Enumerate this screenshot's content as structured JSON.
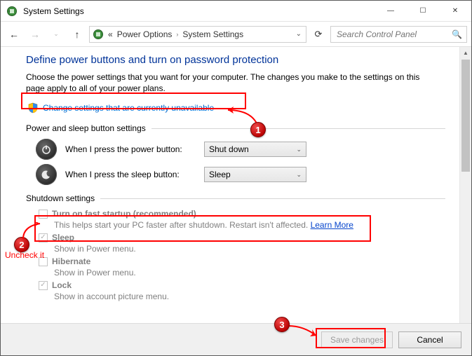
{
  "app": {
    "title": "System Settings"
  },
  "window_controls": {
    "min": "—",
    "max": "☐",
    "close": "✕"
  },
  "nav": {
    "back": "←",
    "forward": "→",
    "up": "↑"
  },
  "breadcrumb": {
    "sep": "›",
    "items": [
      "Power Options",
      "System Settings"
    ]
  },
  "address": {
    "dropdown": "⌄",
    "refresh": "⟳"
  },
  "search": {
    "placeholder": "Search Control Panel"
  },
  "page": {
    "title": "Define power buttons and turn on password protection",
    "description": "Choose the power settings that you want for your computer. The changes you make to the settings on this page apply to all of your power plans.",
    "change_link": "Change settings that are currently unavailable"
  },
  "sections": {
    "power_sleep": {
      "heading": "Power and sleep button settings",
      "rows": [
        {
          "label": "When I press the power button:",
          "value": "Shut down",
          "icon": "power"
        },
        {
          "label": "When I press the sleep button:",
          "value": "Sleep",
          "icon": "sleep"
        }
      ]
    },
    "shutdown": {
      "heading": "Shutdown settings",
      "items": [
        {
          "label": "Turn on fast startup (recommended)",
          "desc": "This helps start your PC faster after shutdown. Restart isn't affected. ",
          "link": "Learn More",
          "checked": false
        },
        {
          "label": "Sleep",
          "desc": "Show in Power menu.",
          "checked": true
        },
        {
          "label": "Hibernate",
          "desc": "Show in Power menu.",
          "checked": false
        },
        {
          "label": "Lock",
          "desc": "Show in account picture menu.",
          "checked": true
        }
      ]
    }
  },
  "footer": {
    "save": "Save changes",
    "cancel": "Cancel"
  },
  "annotations": {
    "bubble1": "1",
    "bubble2": "2",
    "bubble3": "3",
    "uncheck_text": "Uncheck it"
  },
  "icons": {
    "chevron_down": "⌄",
    "check": "✓"
  }
}
